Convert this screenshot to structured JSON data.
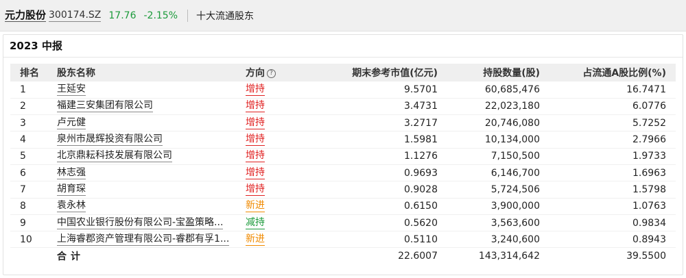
{
  "stock": {
    "name": "元力股份",
    "code": "300174.SZ",
    "price": "17.76",
    "change": "-2.15%",
    "section": "十大流通股东"
  },
  "report": {
    "title": "2023 中报"
  },
  "table": {
    "headers": {
      "rank": "排名",
      "name": "股东名称",
      "direction": "方向",
      "value": "期末参考市值(亿元)",
      "shares": "持股数量(股)",
      "ratio": "占流通A股比例(%)"
    },
    "rows": [
      {
        "rank": "1",
        "name": "王延安",
        "direction": "增持",
        "dir_type": "up",
        "value": "9.5701",
        "shares": "60,685,476",
        "ratio": "16.7471"
      },
      {
        "rank": "2",
        "name": "福建三安集团有限公司",
        "direction": "增持",
        "dir_type": "up",
        "value": "3.4731",
        "shares": "22,023,180",
        "ratio": "6.0776"
      },
      {
        "rank": "3",
        "name": "卢元健",
        "direction": "增持",
        "dir_type": "up",
        "value": "3.2717",
        "shares": "20,746,080",
        "ratio": "5.7252"
      },
      {
        "rank": "4",
        "name": "泉州市晟辉投资有限公司",
        "direction": "增持",
        "dir_type": "up",
        "value": "1.5981",
        "shares": "10,134,000",
        "ratio": "2.7966"
      },
      {
        "rank": "5",
        "name": "北京鼎耘科技发展有限公司",
        "direction": "增持",
        "dir_type": "up",
        "value": "1.1276",
        "shares": "7,150,500",
        "ratio": "1.9733"
      },
      {
        "rank": "6",
        "name": "林志强",
        "direction": "增持",
        "dir_type": "up",
        "value": "0.9693",
        "shares": "6,146,700",
        "ratio": "1.6963"
      },
      {
        "rank": "7",
        "name": "胡育琛",
        "direction": "增持",
        "dir_type": "up",
        "value": "0.9028",
        "shares": "5,724,506",
        "ratio": "1.5798"
      },
      {
        "rank": "8",
        "name": "袁永林",
        "direction": "新进",
        "dir_type": "new",
        "value": "0.6150",
        "shares": "3,900,000",
        "ratio": "1.0763"
      },
      {
        "rank": "9",
        "name": "中国农业银行股份有限公司-宝盈策略...",
        "direction": "减持",
        "dir_type": "down",
        "value": "0.5620",
        "shares": "3,563,600",
        "ratio": "0.9834"
      },
      {
        "rank": "10",
        "name": "上海睿郡资产管理有限公司-睿郡有孚1...",
        "direction": "新进",
        "dir_type": "new",
        "value": "0.5110",
        "shares": "3,240,600",
        "ratio": "0.8943"
      }
    ],
    "total": {
      "label": "合计",
      "value": "22.6007",
      "shares": "143,314,642",
      "ratio": "39.5500"
    }
  },
  "colors": {
    "up": "#e02020",
    "new": "#f08a00",
    "down": "#1b9a3a",
    "header_bg": "#efefef"
  },
  "icons": {
    "direction_help": "question-circle-icon"
  }
}
